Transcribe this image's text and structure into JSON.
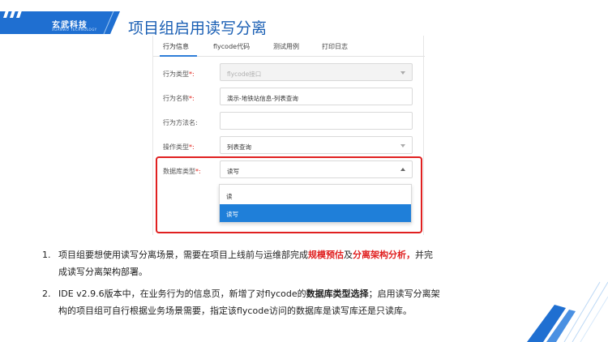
{
  "header": {
    "logo_text": "玄武科技",
    "logo_sub": "XUANWU TECHNOLOGY",
    "title": "项目组启用读写分离"
  },
  "tabs": [
    {
      "label": "行为信息"
    },
    {
      "label": "flycode代码"
    },
    {
      "label": "测试用例"
    },
    {
      "label": "打印日志"
    }
  ],
  "form": {
    "behavior_type": {
      "label": "行为类型",
      "required_mark": "*:",
      "value": "flycode接口"
    },
    "behavior_name": {
      "label": "行为名称",
      "required_mark": "*:",
      "value": "演示-地铁站信息-列表查询"
    },
    "method_name": {
      "label": "行为方法名:",
      "value": ""
    },
    "op_type": {
      "label": "操作类型",
      "required_mark": "*:",
      "value": "列表查询"
    },
    "db_type": {
      "label": "数据库类型",
      "required_mark": "*:",
      "value": "读写"
    }
  },
  "dropdown": {
    "options": [
      "读",
      "读写"
    ],
    "selected": "读写"
  },
  "bullets": {
    "item1": {
      "num": "1.",
      "line1_a": "项目组要想使用读写分离场景，需要在项目上线前与运维部完成",
      "line1_red1": "规模预估",
      "line1_b": "及",
      "line1_red2": "分离架构分析，",
      "line1_c": "并完",
      "line2": "成读写分离架构部署。"
    },
    "item2": {
      "num": "2.",
      "line1_a": "IDE v2.9.6版本中，在业务行为的信息页，新增了对flycode的",
      "line1_bold": "数据库类型选择",
      "line1_b": "；启用读写分离架",
      "line2": "构的项目组可自行根据业务场景需要，指定该flycode访问的数据库是读写库还是只读库。"
    }
  },
  "colors": {
    "brand_blue": "#1a5fb4",
    "highlight_red": "#e02020",
    "selected_blue": "#1f7fd9"
  }
}
